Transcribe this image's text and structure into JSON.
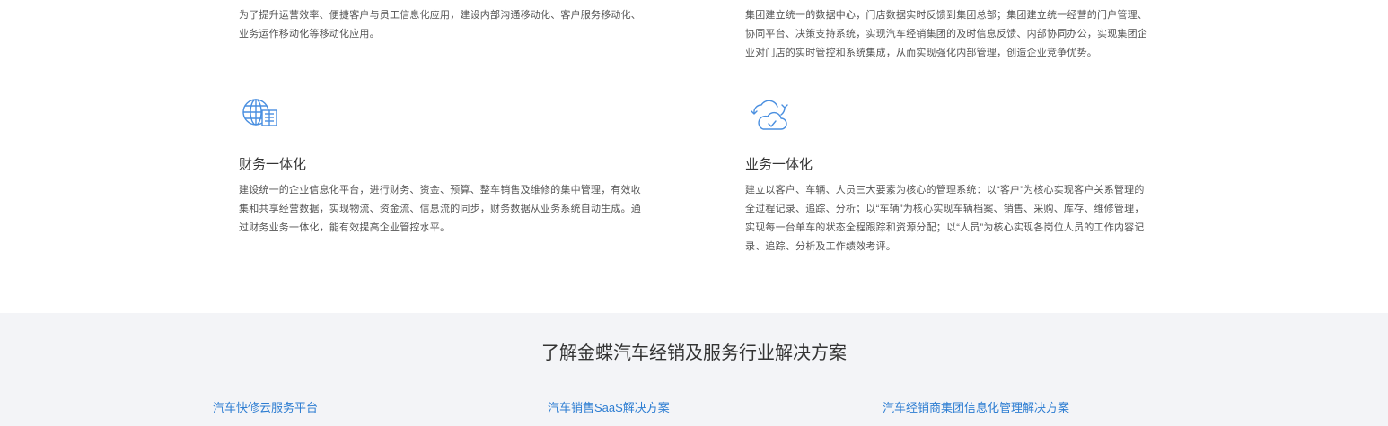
{
  "features": {
    "top_left_desc": [
      "为了提升运营效率、便捷客户与员工信息化应用，建设内部沟通移动化、客户服务移动化、",
      "业务运作移动化等移动化应用。"
    ],
    "top_right_desc": [
      "集团建立统一的数据中心，门店数据实时反馈到集团总部；集团建立统一经营的门户管理、",
      "协同平台、决策支持系统，实现汽车经销集团的及时信息反馈、内部协同办公，实现集团企",
      "业对门店的实时管控和系统集成，从而实现强化内部管理，创造企业竞争优势。"
    ],
    "finance": {
      "icon": "globe-building-icon",
      "title": "财务一体化",
      "desc": [
        "建设统一的企业信息化平台，进行财务、资金、预算、整车销售及维修的集中管理，有效收",
        "集和共享经营数据，实现物流、资金流、信息流的同步，财务数据从业务系统自动生成。通",
        "过财务业务一体化，能有效提高企业管控水平。"
      ]
    },
    "business": {
      "icon": "cloud-sync-icon",
      "title": "业务一体化",
      "desc": [
        "建立以客户、车辆、人员三大要素为核心的管理系统：以“客户”为核心实现客户关系管理的",
        "全过程记录、追踪、分析；以“车辆”为核心实现车辆档案、销售、采购、库存、维修管理，",
        "实现每一台单车的状态全程跟踪和资源分配；以“人员”为核心实现各岗位人员的工作内容记",
        "录、追踪、分析及工作绩效考评。"
      ]
    },
    "accent_color": "#4a8fe0"
  },
  "solutions": {
    "heading": "了解金蝶汽车经销及服务行业解决方案",
    "links": [
      "汽车快修云服务平台",
      "汽车销售SaaS解决方案",
      "汽车经销商集团信息化管理解决方案"
    ],
    "link_color": "#2d7dd2",
    "background": "#f3f4f7"
  }
}
